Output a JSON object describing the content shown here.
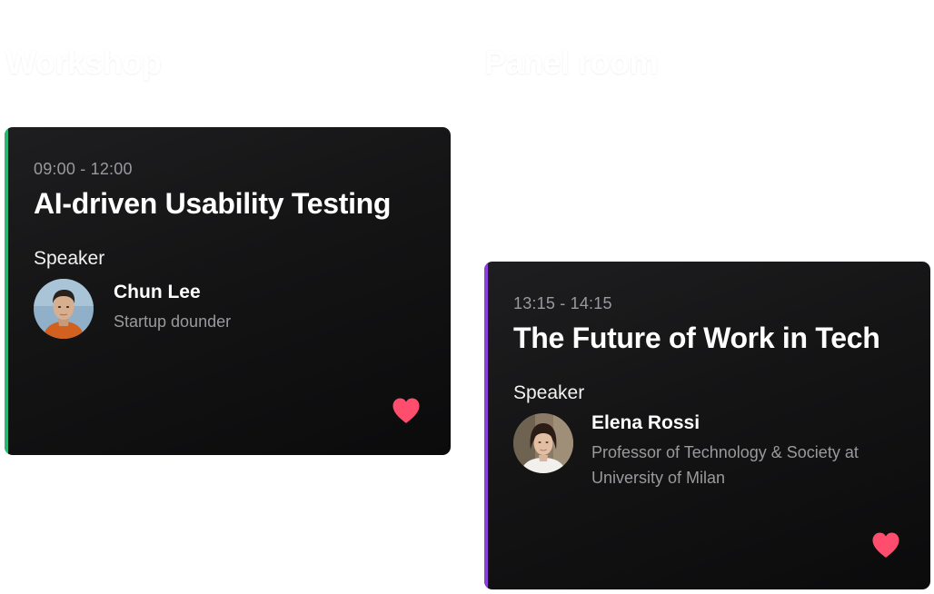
{
  "rooms": [
    {
      "heading": "Workshop"
    },
    {
      "heading": "Panel room"
    }
  ],
  "sessions": [
    {
      "time": "09:00 - 12:00",
      "title": "AI-driven Usability Testing",
      "speaker_label": "Speaker",
      "speaker_name": "Chun Lee",
      "speaker_role": "Startup dounder",
      "accent_color": "#2bb673",
      "favorite_icon": "heart-icon",
      "favorited": true
    },
    {
      "time": "13:15 - 14:15",
      "title": "The Future of Work in Tech",
      "speaker_label": "Speaker",
      "speaker_name": "Elena Rossi",
      "speaker_role": "Professor of Technology & Society at University of Milan",
      "accent_color": "#8b3fd9",
      "favorite_icon": "heart-icon",
      "favorited": true
    }
  ],
  "colors": {
    "card_background": "#141415",
    "heart": "#ff4d6d",
    "muted_text": "#9a9a9e"
  }
}
